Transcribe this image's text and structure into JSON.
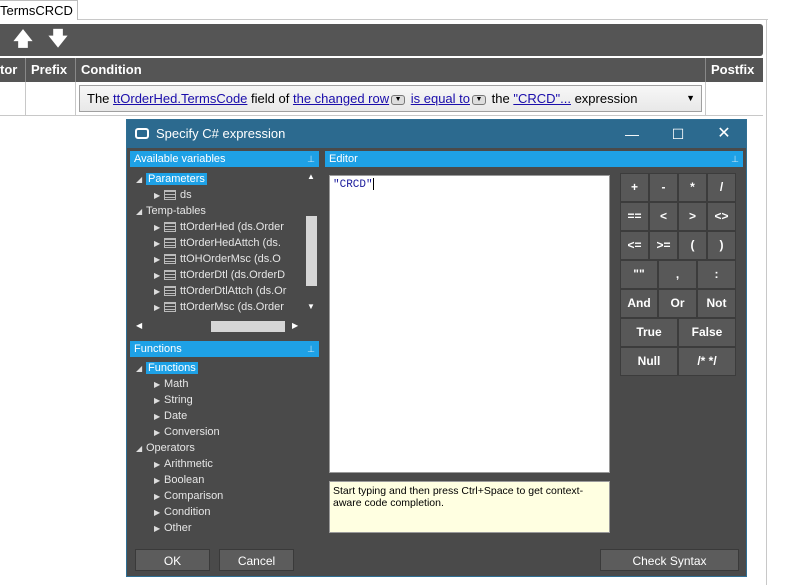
{
  "tab": {
    "label": "TermsCRCD"
  },
  "toolbar": {
    "up_icon": "arrow-up-icon",
    "down_icon": "arrow-down-icon",
    "up_glyph": "🡅",
    "down_glyph": "🡇"
  },
  "grid": {
    "columns": [
      "tor",
      "Prefix",
      "Condition",
      "Postfix"
    ],
    "condition": {
      "the": "The",
      "field_link": "ttOrderHed.TermsCode",
      "field_of": "field of",
      "row_link": "the changed row",
      "op_link": "is equal to",
      "the2": "the",
      "value_link": "\"CRCD\"...",
      "suffix": "expression"
    }
  },
  "dialog": {
    "title": "Specify C# expression",
    "minimize": "—",
    "maximize": "☐",
    "close": "✕",
    "available_variables": {
      "header": "Available variables",
      "tree": [
        {
          "label": "Parameters",
          "level": 0,
          "expanded": true,
          "selected": true
        },
        {
          "label": "ds",
          "level": 1,
          "expanded": false,
          "table": true
        },
        {
          "label": "Temp-tables",
          "level": 0,
          "expanded": true
        },
        {
          "label": "ttOrderHed (ds.Order",
          "level": 1,
          "table": true
        },
        {
          "label": "ttOrderHedAttch (ds.",
          "level": 1,
          "table": true
        },
        {
          "label": "ttOHOrderMsc (ds.O",
          "level": 1,
          "table": true
        },
        {
          "label": "ttOrderDtl (ds.OrderD",
          "level": 1,
          "table": true
        },
        {
          "label": "ttOrderDtlAttch (ds.Or",
          "level": 1,
          "table": true
        },
        {
          "label": "ttOrderMsc (ds.Order",
          "level": 1,
          "table": true
        }
      ]
    },
    "functions": {
      "header": "Functions",
      "tree": [
        {
          "label": "Functions",
          "level": 0,
          "expanded": true,
          "selected": true
        },
        {
          "label": "Math",
          "level": 1
        },
        {
          "label": "String",
          "level": 1
        },
        {
          "label": "Date",
          "level": 1
        },
        {
          "label": "Conversion",
          "level": 1
        },
        {
          "label": "Operators",
          "level": 0,
          "expanded": true
        },
        {
          "label": "Arithmetic",
          "level": 1
        },
        {
          "label": "Boolean",
          "level": 1
        },
        {
          "label": "Comparison",
          "level": 1
        },
        {
          "label": "Condition",
          "level": 1
        },
        {
          "label": "Other",
          "level": 1
        }
      ]
    },
    "editor": {
      "header": "Editor",
      "content": "\"CRCD\"",
      "hint": "Start typing and then press Ctrl+Space to get context-aware code completion."
    },
    "keypad": [
      [
        "+",
        "-",
        "*",
        "/"
      ],
      [
        "==",
        "<",
        ">",
        "<>"
      ],
      [
        "<=",
        ">=",
        "(",
        ")"
      ],
      [
        "\"\"",
        ",",
        ":"
      ]
    ],
    "keypad_wide": [
      [
        "And",
        "Or",
        "Not"
      ],
      [
        "True",
        "False"
      ],
      [
        "Null",
        "/* */"
      ]
    ],
    "buttons": {
      "ok": "OK",
      "cancel": "Cancel",
      "check_syntax": "Check Syntax"
    }
  }
}
